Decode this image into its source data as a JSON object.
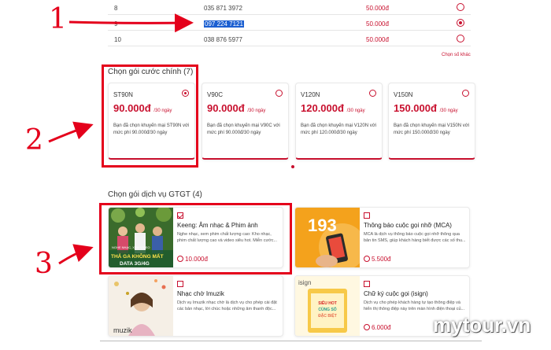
{
  "numbers": {
    "rows": [
      {
        "index": "8",
        "number": "035 871 3972",
        "price": "50.000đ",
        "selected": false
      },
      {
        "index": "9",
        "number": "097 224 7121",
        "price": "50.000đ",
        "selected": true
      },
      {
        "index": "10",
        "number": "038 876 5977",
        "price": "50.000đ",
        "selected": false
      }
    ],
    "more_label": "Chọn số khác"
  },
  "packages": {
    "title": "Chọn gói cước chính (7)",
    "items": [
      {
        "name": "ST90N",
        "price": "90.000đ",
        "period": "/30 ngày",
        "desc": "Bạn đã chọn khuyến mại ST90N với mức phí 90.000đ/30 ngày",
        "selected": true
      },
      {
        "name": "V90C",
        "price": "90.000đ",
        "period": "/30 ngày",
        "desc": "Bạn đã chọn khuyến mại V90C với mức phí 90.000đ/30 ngày",
        "selected": false
      },
      {
        "name": "V120N",
        "price": "120.000đ",
        "period": "/30 ngày",
        "desc": "Bạn đã chọn khuyến mại V120N với mức phí 120.000đ/30 ngày",
        "selected": false
      },
      {
        "name": "V150N",
        "price": "150.000đ",
        "period": "/30 ngày",
        "desc": "Bạn đã chọn khuyến mại V150N với mức phí 150.000đ/30 ngày",
        "selected": false
      }
    ]
  },
  "services": {
    "title": "Chọn gói dịch vụ GTGT (4)",
    "items": [
      {
        "title": "Keeng: Âm nhạc & Phim ảnh",
        "desc": "Nghe nhạc, xem phim chất lượng cao: Kho nhạc, phim chất lượng cao và video siêu hot. Miễn cước...",
        "price": "10.000đ",
        "checked": true,
        "thumb_text_1": "NGHE NHẠC, XEM VIDEO",
        "thumb_text_2": "THẢ GA KHÔNG MẤT",
        "thumb_text_3": "DATA 3G/4G"
      },
      {
        "title": "Thông báo cuộc gọi nhỡ (MCA)",
        "desc": "MCA là dịch vụ thông báo cuộc gọi nhỡ thông qua bản tin SMS, giúp khách hàng biết được các số thu...",
        "price": "5.500đ",
        "checked": false,
        "thumb_text_1": "193"
      },
      {
        "title": "Nhạc chờ Imuzik",
        "desc": "Dịch vụ Imuzik nhạc chờ là dịch vụ cho phép cài đặt các bản nhạc, lời chúc hoặc những âm thanh độc...",
        "price": "",
        "checked": false,
        "thumb_text_1": "muzik"
      },
      {
        "title": "Chữ ký cuộc gọi (isign)",
        "desc": "Dịch vụ cho phép khách hàng tự tạo thông điệp và hiển thị thông điệp này trên màn hình điện thoại củ...",
        "price": "6.000đ",
        "checked": false,
        "thumb_text_1": "isign",
        "thumb_text_2": "SIÊU HOT CÙNG SỐ ĐẶC BIỆT"
      }
    ]
  },
  "annotations": [
    "1",
    "2",
    "3"
  ],
  "watermark": "mytour.vn",
  "colors": {
    "accent": "#c8102e",
    "annotation": "#e4001b",
    "selection": "#1b5fd1"
  }
}
